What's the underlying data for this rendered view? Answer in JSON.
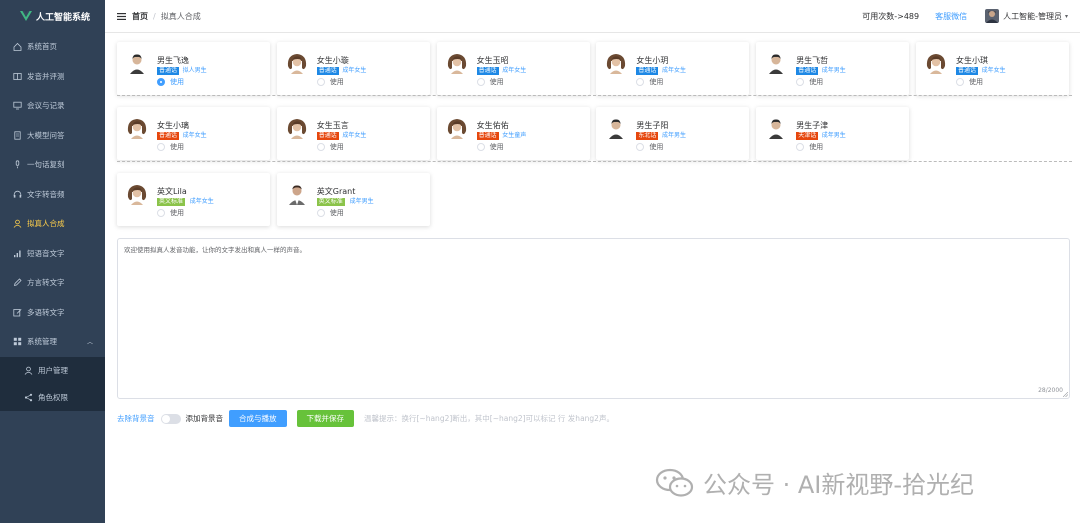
{
  "app": {
    "title": "人工智能系统"
  },
  "sidebar": {
    "items": [
      {
        "label": "系统首页",
        "icon": "home-icon"
      },
      {
        "label": "发音并评测",
        "icon": "book-icon"
      },
      {
        "label": "会议与记录",
        "icon": "monitor-icon"
      },
      {
        "label": "大模型问答",
        "icon": "document-icon"
      },
      {
        "label": "一句话复刻",
        "icon": "microphone-icon"
      },
      {
        "label": "文字转音频",
        "icon": "headset-icon"
      },
      {
        "label": "拟真人合成",
        "icon": "user-icon",
        "active": true
      },
      {
        "label": "短语音文字",
        "icon": "signal-icon"
      },
      {
        "label": "方言转文字",
        "icon": "pen-icon"
      },
      {
        "label": "多语转文字",
        "icon": "edit-icon"
      },
      {
        "label": "系统管理",
        "icon": "grid-icon",
        "expanded": true
      }
    ],
    "subitems": [
      {
        "label": "用户管理",
        "icon": "user-icon"
      },
      {
        "label": "角色权限",
        "icon": "share-icon"
      }
    ]
  },
  "header": {
    "breadcrumb_home": "首页",
    "breadcrumb_sep": "/",
    "breadcrumb_current": "拟真人合成",
    "quota": "可用次数->489",
    "service": "客服微信",
    "user": "人工智能-管理员"
  },
  "voices": {
    "use_label": "使用",
    "rows": [
      [
        {
          "name": "男生飞逸",
          "tag": "普通话",
          "desc": "拟人男生",
          "gender": "m",
          "selected": true
        },
        {
          "name": "女生小璇",
          "tag": "普通话",
          "desc": "成年女生",
          "gender": "f"
        },
        {
          "name": "女生玉昭",
          "tag": "普通话",
          "desc": "成年女生",
          "gender": "f"
        },
        {
          "name": "女生小玥",
          "tag": "普通话",
          "desc": "成年女生",
          "gender": "f"
        },
        {
          "name": "男生飞哲",
          "tag": "普通话",
          "desc": "成年男生",
          "gender": "m"
        },
        {
          "name": "女生小琪",
          "tag": "普通话",
          "desc": "成年女生",
          "gender": "f"
        }
      ],
      [
        {
          "name": "女生小璃",
          "tag": "普通话",
          "desc": "成年女生",
          "gender": "f",
          "tag_color": "#e6470e"
        },
        {
          "name": "女生玉言",
          "tag": "普通话",
          "desc": "成年女生",
          "gender": "f",
          "tag_color": "#e6470e"
        },
        {
          "name": "女生佑佑",
          "tag": "普通话",
          "desc": "女生童声",
          "gender": "f",
          "tag_color": "#e6470e"
        },
        {
          "name": "男生子阳",
          "tag": "东北话",
          "desc": "成年男生",
          "gender": "m",
          "tag_color": "#e6470e"
        },
        {
          "name": "男生子津",
          "tag": "天津话",
          "desc": "成年男生",
          "gender": "m",
          "tag_color": "#e6470e"
        }
      ],
      [
        {
          "name": "英文Lila",
          "tag": "英文标准",
          "desc": "成年女生",
          "gender": "f",
          "tag_color": "#8bc34a"
        },
        {
          "name": "英文Grant",
          "tag": "英文标准",
          "desc": "成年男生",
          "gender": "m2",
          "tag_color": "#8bc34a"
        }
      ]
    ]
  },
  "textbox": {
    "content": "欢迎使用拟真人发音功能，让你的文字发出和真人一样的声音。",
    "counter": "28/2000"
  },
  "controls": {
    "remove_bg": "去除背景音",
    "add_bg": "添加背景音",
    "synth_btn": "合成与播放",
    "download_btn": "下载并保存",
    "tip": "温馨提示：换行[~hang2]断出，其中[~hang2]可以标记 行 发hang2声。"
  },
  "watermark": {
    "text": "公众号 · AI新视野-拾光纪"
  },
  "colors": {
    "sidebar_bg": "#304156",
    "accent": "#409eff",
    "active_menu": "#ffd04b",
    "tag_blue": "#1e88e5",
    "tag_red": "#e6470e",
    "tag_green": "#8bc34a",
    "btn_green": "#67c23a"
  }
}
